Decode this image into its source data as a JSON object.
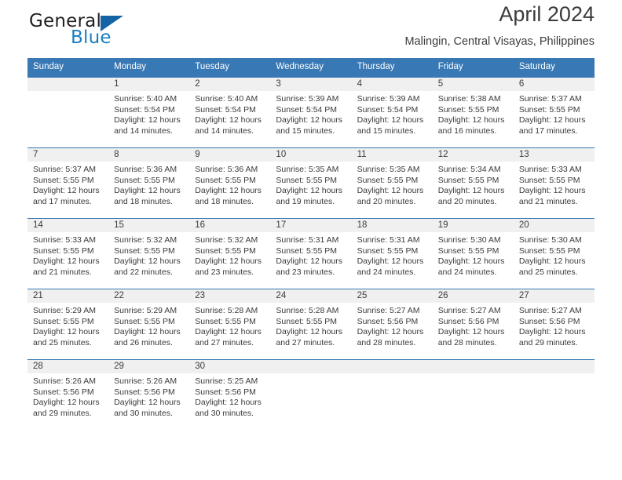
{
  "brand": {
    "name_top": "General",
    "name_bottom": "Blue",
    "accent_color": "#1464a5",
    "blue_text_color": "#1a7fc1",
    "triangle_icon": "triangle-icon"
  },
  "header": {
    "title": "April 2024",
    "subtitle": "Malingin, Central Visayas, Philippines"
  },
  "calendar": {
    "header_bg": "#3878b4",
    "day_band_bg": "#f0f0f0",
    "weekdays": [
      "Sunday",
      "Monday",
      "Tuesday",
      "Wednesday",
      "Thursday",
      "Friday",
      "Saturday"
    ],
    "weeks": [
      [
        {
          "day": "",
          "sunrise": "",
          "sunset": "",
          "daylight": ""
        },
        {
          "day": "1",
          "sunrise": "Sunrise: 5:40 AM",
          "sunset": "Sunset: 5:54 PM",
          "daylight": "Daylight: 12 hours and 14 minutes."
        },
        {
          "day": "2",
          "sunrise": "Sunrise: 5:40 AM",
          "sunset": "Sunset: 5:54 PM",
          "daylight": "Daylight: 12 hours and 14 minutes."
        },
        {
          "day": "3",
          "sunrise": "Sunrise: 5:39 AM",
          "sunset": "Sunset: 5:54 PM",
          "daylight": "Daylight: 12 hours and 15 minutes."
        },
        {
          "day": "4",
          "sunrise": "Sunrise: 5:39 AM",
          "sunset": "Sunset: 5:54 PM",
          "daylight": "Daylight: 12 hours and 15 minutes."
        },
        {
          "day": "5",
          "sunrise": "Sunrise: 5:38 AM",
          "sunset": "Sunset: 5:55 PM",
          "daylight": "Daylight: 12 hours and 16 minutes."
        },
        {
          "day": "6",
          "sunrise": "Sunrise: 5:37 AM",
          "sunset": "Sunset: 5:55 PM",
          "daylight": "Daylight: 12 hours and 17 minutes."
        }
      ],
      [
        {
          "day": "7",
          "sunrise": "Sunrise: 5:37 AM",
          "sunset": "Sunset: 5:55 PM",
          "daylight": "Daylight: 12 hours and 17 minutes."
        },
        {
          "day": "8",
          "sunrise": "Sunrise: 5:36 AM",
          "sunset": "Sunset: 5:55 PM",
          "daylight": "Daylight: 12 hours and 18 minutes."
        },
        {
          "day": "9",
          "sunrise": "Sunrise: 5:36 AM",
          "sunset": "Sunset: 5:55 PM",
          "daylight": "Daylight: 12 hours and 18 minutes."
        },
        {
          "day": "10",
          "sunrise": "Sunrise: 5:35 AM",
          "sunset": "Sunset: 5:55 PM",
          "daylight": "Daylight: 12 hours and 19 minutes."
        },
        {
          "day": "11",
          "sunrise": "Sunrise: 5:35 AM",
          "sunset": "Sunset: 5:55 PM",
          "daylight": "Daylight: 12 hours and 20 minutes."
        },
        {
          "day": "12",
          "sunrise": "Sunrise: 5:34 AM",
          "sunset": "Sunset: 5:55 PM",
          "daylight": "Daylight: 12 hours and 20 minutes."
        },
        {
          "day": "13",
          "sunrise": "Sunrise: 5:33 AM",
          "sunset": "Sunset: 5:55 PM",
          "daylight": "Daylight: 12 hours and 21 minutes."
        }
      ],
      [
        {
          "day": "14",
          "sunrise": "Sunrise: 5:33 AM",
          "sunset": "Sunset: 5:55 PM",
          "daylight": "Daylight: 12 hours and 21 minutes."
        },
        {
          "day": "15",
          "sunrise": "Sunrise: 5:32 AM",
          "sunset": "Sunset: 5:55 PM",
          "daylight": "Daylight: 12 hours and 22 minutes."
        },
        {
          "day": "16",
          "sunrise": "Sunrise: 5:32 AM",
          "sunset": "Sunset: 5:55 PM",
          "daylight": "Daylight: 12 hours and 23 minutes."
        },
        {
          "day": "17",
          "sunrise": "Sunrise: 5:31 AM",
          "sunset": "Sunset: 5:55 PM",
          "daylight": "Daylight: 12 hours and 23 minutes."
        },
        {
          "day": "18",
          "sunrise": "Sunrise: 5:31 AM",
          "sunset": "Sunset: 5:55 PM",
          "daylight": "Daylight: 12 hours and 24 minutes."
        },
        {
          "day": "19",
          "sunrise": "Sunrise: 5:30 AM",
          "sunset": "Sunset: 5:55 PM",
          "daylight": "Daylight: 12 hours and 24 minutes."
        },
        {
          "day": "20",
          "sunrise": "Sunrise: 5:30 AM",
          "sunset": "Sunset: 5:55 PM",
          "daylight": "Daylight: 12 hours and 25 minutes."
        }
      ],
      [
        {
          "day": "21",
          "sunrise": "Sunrise: 5:29 AM",
          "sunset": "Sunset: 5:55 PM",
          "daylight": "Daylight: 12 hours and 25 minutes."
        },
        {
          "day": "22",
          "sunrise": "Sunrise: 5:29 AM",
          "sunset": "Sunset: 5:55 PM",
          "daylight": "Daylight: 12 hours and 26 minutes."
        },
        {
          "day": "23",
          "sunrise": "Sunrise: 5:28 AM",
          "sunset": "Sunset: 5:55 PM",
          "daylight": "Daylight: 12 hours and 27 minutes."
        },
        {
          "day": "24",
          "sunrise": "Sunrise: 5:28 AM",
          "sunset": "Sunset: 5:55 PM",
          "daylight": "Daylight: 12 hours and 27 minutes."
        },
        {
          "day": "25",
          "sunrise": "Sunrise: 5:27 AM",
          "sunset": "Sunset: 5:56 PM",
          "daylight": "Daylight: 12 hours and 28 minutes."
        },
        {
          "day": "26",
          "sunrise": "Sunrise: 5:27 AM",
          "sunset": "Sunset: 5:56 PM",
          "daylight": "Daylight: 12 hours and 28 minutes."
        },
        {
          "day": "27",
          "sunrise": "Sunrise: 5:27 AM",
          "sunset": "Sunset: 5:56 PM",
          "daylight": "Daylight: 12 hours and 29 minutes."
        }
      ],
      [
        {
          "day": "28",
          "sunrise": "Sunrise: 5:26 AM",
          "sunset": "Sunset: 5:56 PM",
          "daylight": "Daylight: 12 hours and 29 minutes."
        },
        {
          "day": "29",
          "sunrise": "Sunrise: 5:26 AM",
          "sunset": "Sunset: 5:56 PM",
          "daylight": "Daylight: 12 hours and 30 minutes."
        },
        {
          "day": "30",
          "sunrise": "Sunrise: 5:25 AM",
          "sunset": "Sunset: 5:56 PM",
          "daylight": "Daylight: 12 hours and 30 minutes."
        },
        {
          "day": "",
          "sunrise": "",
          "sunset": "",
          "daylight": ""
        },
        {
          "day": "",
          "sunrise": "",
          "sunset": "",
          "daylight": ""
        },
        {
          "day": "",
          "sunrise": "",
          "sunset": "",
          "daylight": ""
        },
        {
          "day": "",
          "sunrise": "",
          "sunset": "",
          "daylight": ""
        }
      ]
    ]
  }
}
